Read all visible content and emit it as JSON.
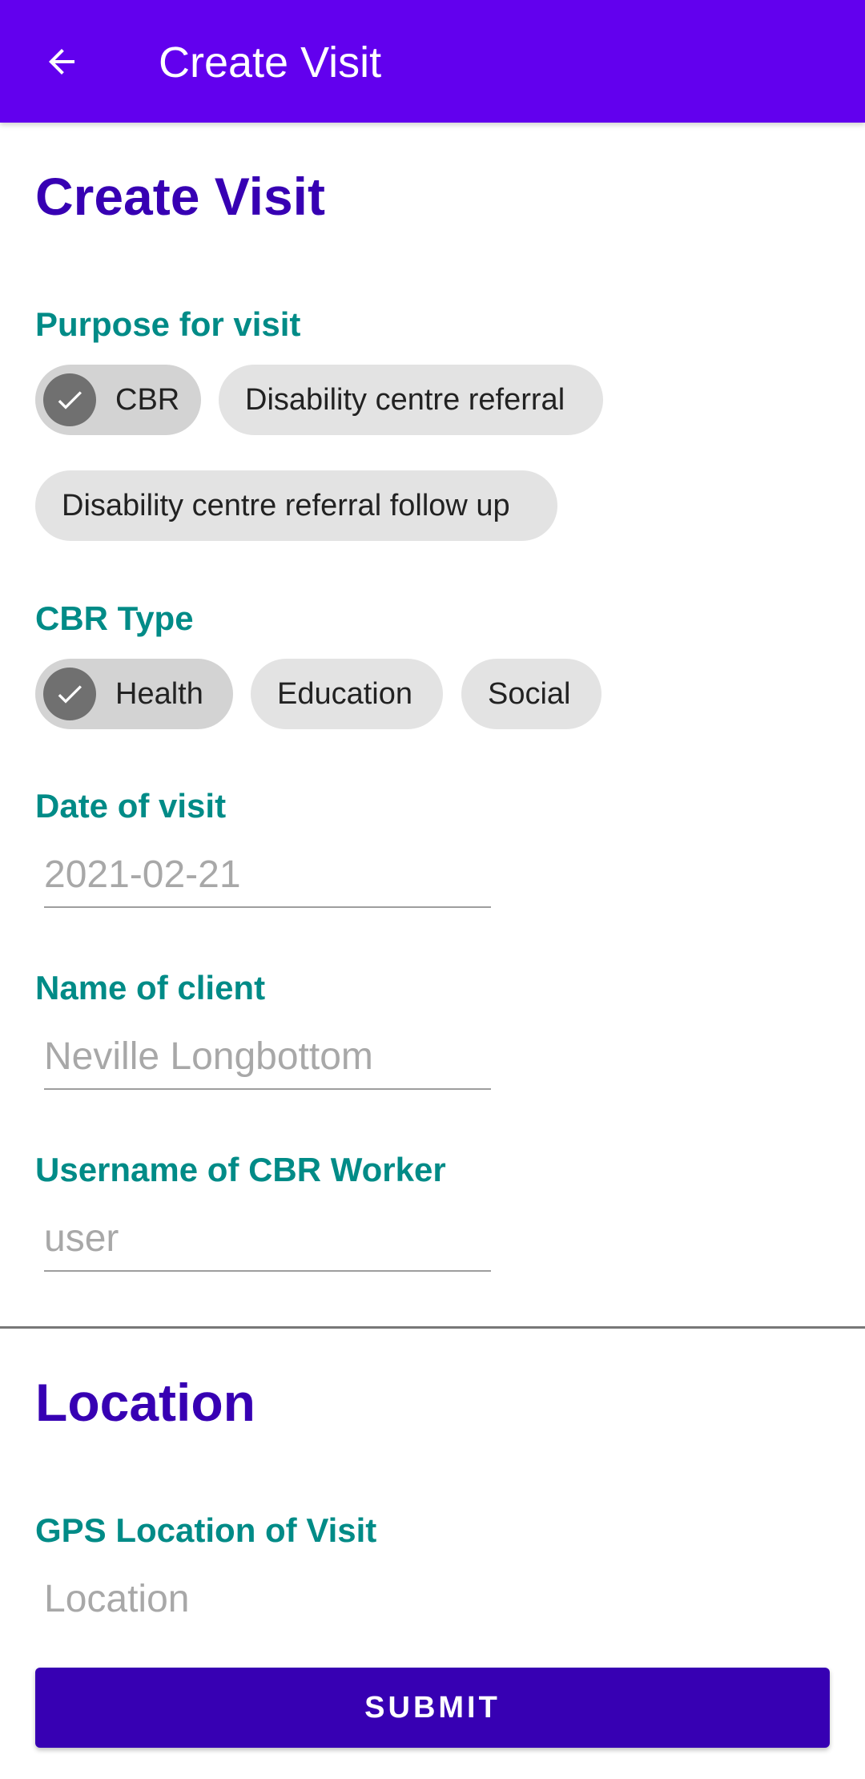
{
  "app_bar": {
    "back_icon": "arrow-back-icon",
    "title": "Create Visit"
  },
  "main": {
    "heading": "Create Visit",
    "purpose": {
      "label": "Purpose for visit",
      "chips": [
        {
          "label": "CBR",
          "selected": true
        },
        {
          "label": "Disability centre referral",
          "selected": false
        },
        {
          "label": "Disability centre referral follow up",
          "selected": false
        }
      ]
    },
    "cbr_type": {
      "label": "CBR Type",
      "chips": [
        {
          "label": "Health",
          "selected": true
        },
        {
          "label": "Education",
          "selected": false
        },
        {
          "label": "Social",
          "selected": false
        }
      ]
    },
    "date": {
      "label": "Date of visit",
      "value": "2021-02-21"
    },
    "client": {
      "label": "Name of client",
      "value": "Neville Longbottom"
    },
    "worker": {
      "label": "Username of CBR Worker",
      "value": "user"
    }
  },
  "location": {
    "heading": "Location",
    "gps": {
      "label": "GPS Location of Visit",
      "placeholder": "Location"
    }
  },
  "submit_label": "SUBMIT",
  "colors": {
    "app_bar": "#6200EE",
    "heading": "#3700B3",
    "label": "#008B87",
    "submit": "#3700B3",
    "chip": "#E3E3E3",
    "chip_selected": "#D3D3D3"
  }
}
